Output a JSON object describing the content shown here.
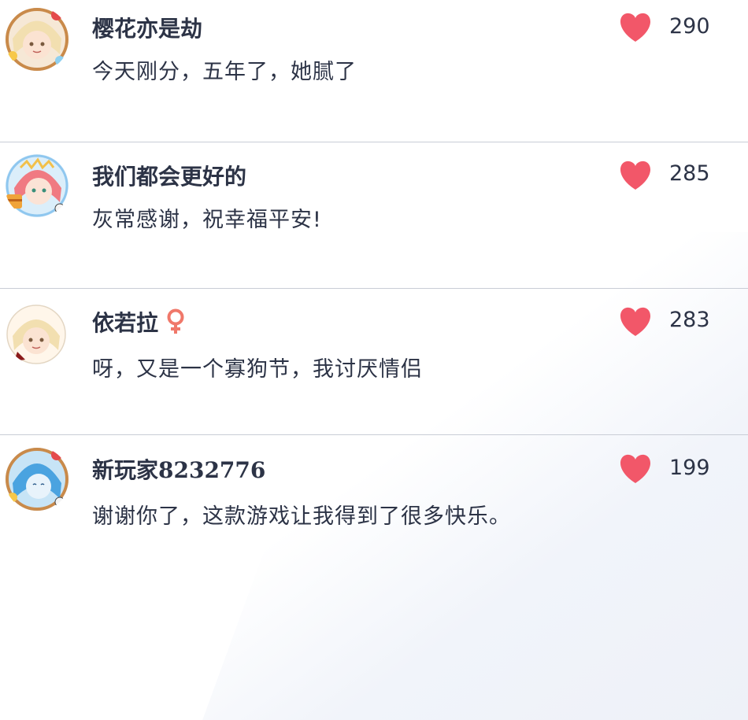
{
  "colors": {
    "heart": "#f25769",
    "text": "#2c3346",
    "divider": "#c9cdd6"
  },
  "comments": [
    {
      "username": "樱花亦是劫",
      "text": "今天刚分，五年了，她腻了",
      "likes": "290",
      "avatar_icon": "blonde-character-avatar-icon",
      "gender_icon": null
    },
    {
      "username": "我们都会更好的",
      "text": "灰常感谢，祝幸福平安!",
      "likes": "285",
      "avatar_icon": "red-hair-character-avatar-icon",
      "gender_icon": null
    },
    {
      "username": "依若拉",
      "text": "呀，又是一个寡狗节，我讨厌情侣",
      "likes": "283",
      "avatar_icon": "blonde-character-avatar-icon",
      "gender_icon": "female-icon"
    },
    {
      "username": "新玩家8232776",
      "text": "谢谢你了，这款游戏让我得到了很多快乐。",
      "likes": "199",
      "avatar_icon": "blue-hair-character-avatar-icon",
      "gender_icon": null
    }
  ]
}
